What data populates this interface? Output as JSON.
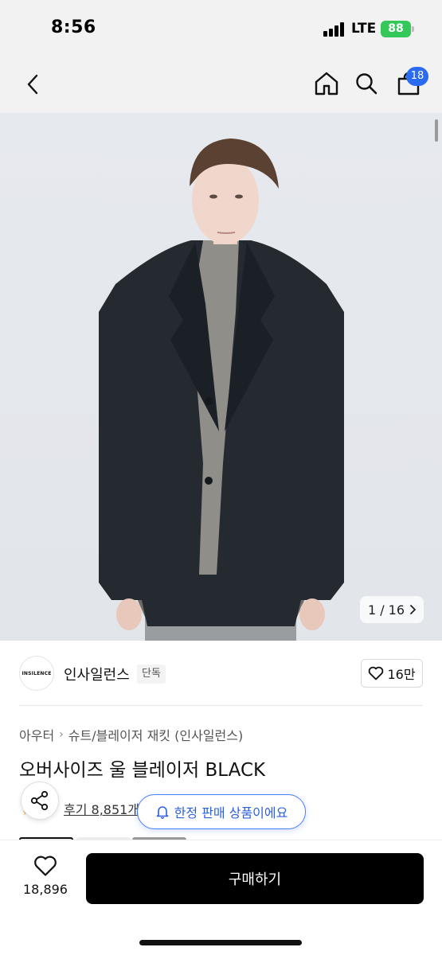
{
  "status_bar": {
    "time": "8:56",
    "network": "LTE",
    "battery": "88"
  },
  "header": {
    "cart_count": "18",
    "icons": [
      "back-chevron-icon",
      "home-icon",
      "search-icon",
      "shopping-bag-icon"
    ]
  },
  "gallery": {
    "counter": "1 / 16"
  },
  "brand": {
    "logo_text": "INSILENCE",
    "name": "인사일런스",
    "tag": "단독",
    "likes": "16만"
  },
  "product": {
    "category_root": "아우터",
    "category_path": "슈트/블레이저 재킷 (인사일런스)",
    "title": "오버사이즈 울 블레이저 BLACK",
    "review_text": "후기 8,851개",
    "limited_text": "한정 판매 상품이에요"
  },
  "bottom_bar": {
    "wish_count": "18,896",
    "buy_label": "구매하기"
  },
  "colors": {
    "accent_blue": "#2b6af3",
    "battery_green": "#34c759",
    "buy_button": "#000000"
  }
}
